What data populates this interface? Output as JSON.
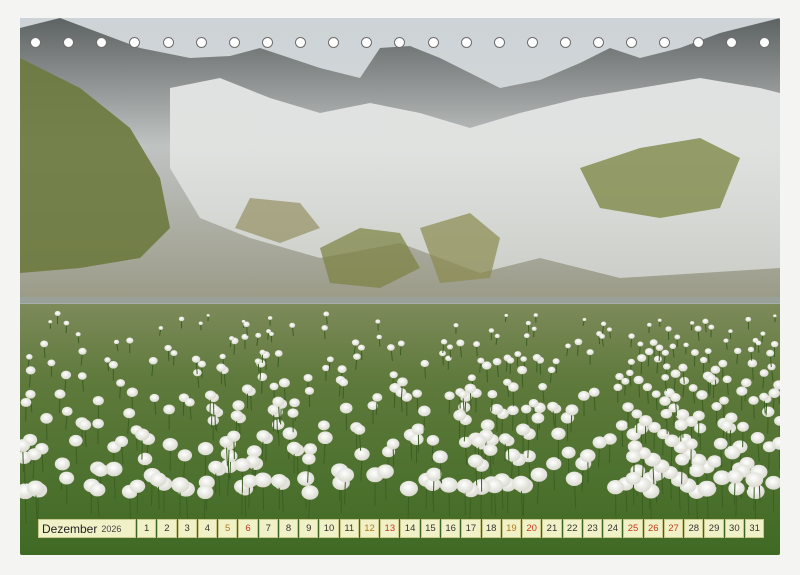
{
  "calendar": {
    "month": "Dezember",
    "year": "2026",
    "ring_hole_count": 23,
    "colors": {
      "strip_background": "#f1f1c8",
      "weekday_text": "#333333",
      "saturday_text": "#b0781f",
      "sunday_holiday_text": "#c43a1e"
    },
    "days": [
      {
        "label": "1",
        "kind": "weekday"
      },
      {
        "label": "2",
        "kind": "weekday"
      },
      {
        "label": "3",
        "kind": "weekday"
      },
      {
        "label": "4",
        "kind": "weekday"
      },
      {
        "label": "5",
        "kind": "sat"
      },
      {
        "label": "6",
        "kind": "sun"
      },
      {
        "label": "7",
        "kind": "weekday"
      },
      {
        "label": "8",
        "kind": "weekday"
      },
      {
        "label": "9",
        "kind": "weekday"
      },
      {
        "label": "10",
        "kind": "weekday"
      },
      {
        "label": "11",
        "kind": "weekday"
      },
      {
        "label": "12",
        "kind": "sat"
      },
      {
        "label": "13",
        "kind": "sun"
      },
      {
        "label": "14",
        "kind": "weekday"
      },
      {
        "label": "15",
        "kind": "weekday"
      },
      {
        "label": "16",
        "kind": "weekday"
      },
      {
        "label": "17",
        "kind": "weekday"
      },
      {
        "label": "18",
        "kind": "weekday"
      },
      {
        "label": "19",
        "kind": "sat"
      },
      {
        "label": "20",
        "kind": "sun"
      },
      {
        "label": "21",
        "kind": "weekday"
      },
      {
        "label": "22",
        "kind": "weekday"
      },
      {
        "label": "23",
        "kind": "weekday"
      },
      {
        "label": "24",
        "kind": "weekday"
      },
      {
        "label": "25",
        "kind": "holiday"
      },
      {
        "label": "26",
        "kind": "holiday"
      },
      {
        "label": "27",
        "kind": "sun"
      },
      {
        "label": "28",
        "kind": "weekday"
      },
      {
        "label": "29",
        "kind": "weekday"
      },
      {
        "label": "30",
        "kind": "weekday"
      },
      {
        "label": "31",
        "kind": "weekday"
      }
    ]
  }
}
